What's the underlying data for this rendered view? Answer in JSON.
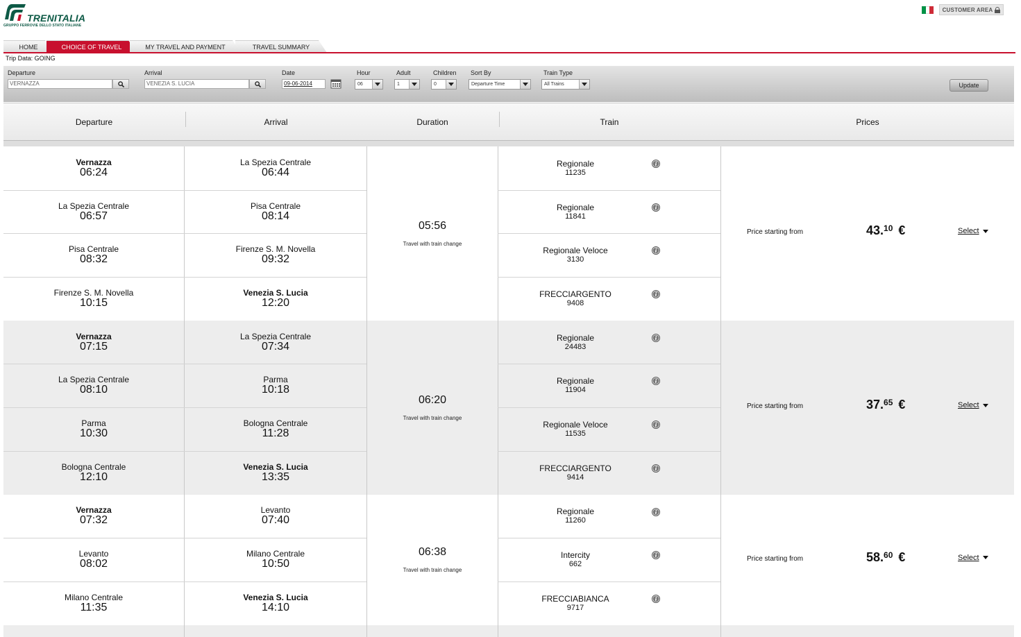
{
  "header": {
    "brand": "TRENITALIA",
    "brand_sub": "GRUPPO FERROVIE DELLO STATO ITALIANE",
    "customer_area": "CUSTOMER AREA",
    "colors": {
      "brand_green": "#0e5a46",
      "accent_red": "#c8102e"
    }
  },
  "tabs": [
    {
      "label": "HOME"
    },
    {
      "label": "CHOICE OF TRAVEL"
    },
    {
      "label": "MY TRAVEL AND PAYMENT"
    },
    {
      "label": "TRAVEL SUMMARY"
    }
  ],
  "trip_data": "Trip Data:  GOING",
  "search": {
    "departure_label": "Departure",
    "departure_value": "VERNAZZA",
    "arrival_label": "Arrival",
    "arrival_value": "VENEZIA S. LUCIA",
    "date_label": "Date",
    "date_value": "09-06-2014",
    "hour_label": "Hour",
    "hour_value": "06",
    "adult_label": "Adult",
    "adult_value": "1",
    "children_label": "Children",
    "children_value": "0",
    "sort_label": "Sort By",
    "sort_value": "Departure Time",
    "train_type_label": "Train Type",
    "train_type_value": "All Trains",
    "update_label": "Update"
  },
  "columns": {
    "departure": "Departure",
    "arrival": "Arrival",
    "duration": "Duration",
    "train": "Train",
    "prices": "Prices"
  },
  "results": [
    {
      "duration": "05:56",
      "note": "Travel with train change",
      "price_label": "Price starting from",
      "price_int": "43.",
      "price_dec": "10",
      "currency": "€",
      "select_label": "Select",
      "legs": [
        {
          "dep": "Vernazza",
          "dep_time": "06:24",
          "arr": "La Spezia Centrale",
          "arr_time": "06:44",
          "train": "Regionale",
          "number": "11235"
        },
        {
          "dep": "La Spezia Centrale",
          "dep_time": "06:57",
          "arr": "Pisa Centrale",
          "arr_time": "08:14",
          "train": "Regionale",
          "number": "11841"
        },
        {
          "dep": "Pisa Centrale",
          "dep_time": "08:32",
          "arr": "Firenze S. M. Novella",
          "arr_time": "09:32",
          "train": "Regionale Veloce",
          "number": "3130"
        },
        {
          "dep": "Firenze S. M. Novella",
          "dep_time": "10:15",
          "arr": "Venezia S. Lucia",
          "arr_time": "12:20",
          "train": "FRECCIARGENTO",
          "number": "9408"
        }
      ]
    },
    {
      "duration": "06:20",
      "note": "Travel with train change",
      "price_label": "Price starting from",
      "price_int": "37.",
      "price_dec": "65",
      "currency": "€",
      "select_label": "Select",
      "legs": [
        {
          "dep": "Vernazza",
          "dep_time": "07:15",
          "arr": "La Spezia Centrale",
          "arr_time": "07:34",
          "train": "Regionale",
          "number": "24483"
        },
        {
          "dep": "La Spezia Centrale",
          "dep_time": "08:10",
          "arr": "Parma",
          "arr_time": "10:18",
          "train": "Regionale",
          "number": "11904"
        },
        {
          "dep": "Parma",
          "dep_time": "10:30",
          "arr": "Bologna Centrale",
          "arr_time": "11:28",
          "train": "Regionale Veloce",
          "number": "11535"
        },
        {
          "dep": "Bologna Centrale",
          "dep_time": "12:10",
          "arr": "Venezia S. Lucia",
          "arr_time": "13:35",
          "train": "FRECCIARGENTO",
          "number": "9414"
        }
      ]
    },
    {
      "duration": "06:38",
      "note": "Travel with train change",
      "price_label": "Price starting from",
      "price_int": "58.",
      "price_dec": "60",
      "currency": "€",
      "select_label": "Select",
      "legs": [
        {
          "dep": "Vernazza",
          "dep_time": "07:32",
          "arr": "Levanto",
          "arr_time": "07:40",
          "train": "Regionale",
          "number": "11260"
        },
        {
          "dep": "Levanto",
          "dep_time": "08:02",
          "arr": "Milano Centrale",
          "arr_time": "10:50",
          "train": "Intercity",
          "number": "662"
        },
        {
          "dep": "Milano Centrale",
          "dep_time": "11:35",
          "arr": "Venezia S. Lucia",
          "arr_time": "14:10",
          "train": "FRECCIABIANCA",
          "number": "9717"
        }
      ]
    }
  ]
}
